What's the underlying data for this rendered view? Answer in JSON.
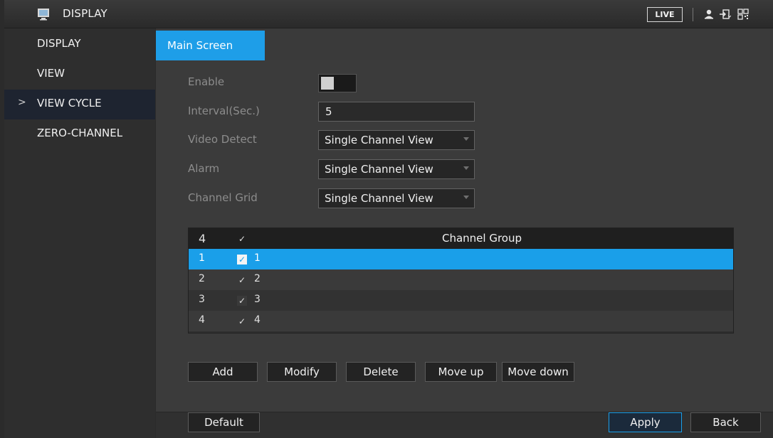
{
  "header": {
    "title": "DISPLAY",
    "live_label": "LIVE",
    "icons": [
      "monitor-icon",
      "user-icon",
      "logout-icon",
      "qr-code-icon"
    ]
  },
  "sidebar": {
    "items": [
      {
        "label": "DISPLAY",
        "active": false
      },
      {
        "label": "VIEW",
        "active": false
      },
      {
        "label": "VIEW CYCLE",
        "active": true
      },
      {
        "label": "ZERO-CHANNEL",
        "active": false
      }
    ],
    "active_marker": ">"
  },
  "tabs": [
    {
      "label": "Main Screen",
      "active": true
    }
  ],
  "form": {
    "enable_label": "Enable",
    "enable_state": "off",
    "interval_label": "Interval(Sec.)",
    "interval_value": "5",
    "video_detect_label": "Video Detect",
    "video_detect_value": "Single Channel View",
    "alarm_label": "Alarm",
    "alarm_value": "Single Channel View",
    "channel_grid_label": "Channel Grid",
    "channel_grid_value": "Single Channel View"
  },
  "table": {
    "header_count": "4",
    "header_check": "✓",
    "header_title": "Channel Group",
    "rows": [
      {
        "idx": "1",
        "check": "✓",
        "name": "1",
        "selected": true
      },
      {
        "idx": "2",
        "check": "✓",
        "name": "2",
        "selected": false
      },
      {
        "idx": "3",
        "check": "✓",
        "name": "3",
        "selected": false
      },
      {
        "idx": "4",
        "check": "✓",
        "name": "4",
        "selected": false
      }
    ]
  },
  "actions": {
    "add": "Add",
    "modify": "Modify",
    "delete": "Delete",
    "move_up": "Move up",
    "move_down": "Move down"
  },
  "footer": {
    "default": "Default",
    "apply": "Apply",
    "back": "Back"
  },
  "colors": {
    "accent": "#1a9fe9",
    "panel": "#3b3b3b",
    "sidebar": "#2e2e2e"
  }
}
